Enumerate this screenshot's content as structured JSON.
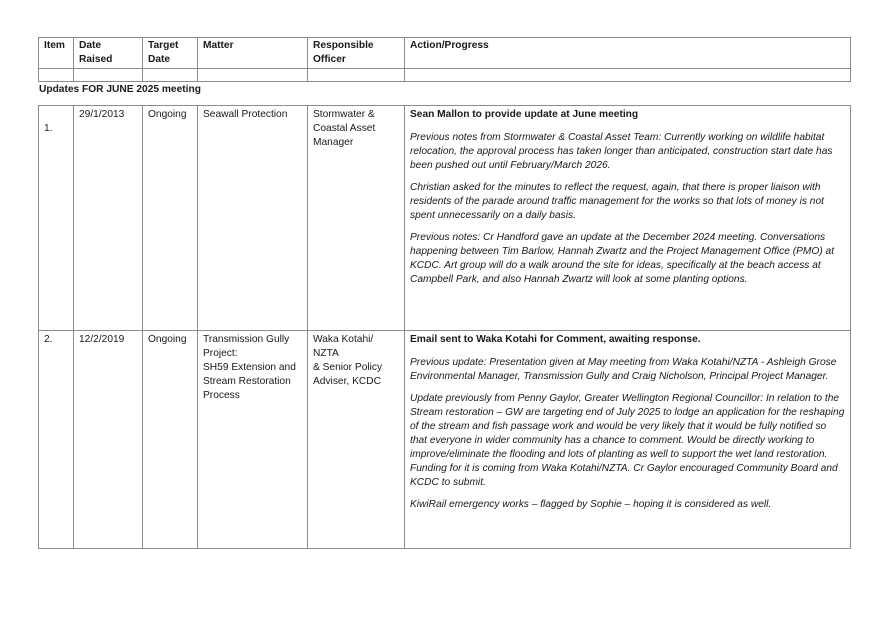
{
  "header": {
    "item": "Item",
    "date_raised": "Date Raised",
    "target_date": "Target Date",
    "matter": "Matter",
    "responsible_officer": "Responsible Officer",
    "action_progress": "Action/Progress"
  },
  "section_heading": "Updates FOR JUNE 2025 meeting",
  "rows": [
    {
      "item": "1.",
      "date_raised": "29/1/2013",
      "target_date": "Ongoing",
      "matter": "Seawall Protection",
      "responsible_officer": "Stormwater & Coastal Asset Manager",
      "lead": "Sean Mallon to provide update at June meeting",
      "notes": [
        "Previous notes from Stormwater & Coastal Asset Team: Currently working on wildlife habitat relocation, the approval process has taken longer than anticipated, construction start date has been pushed out until February/March 2026.",
        "Christian asked for the minutes to reflect the request, again, that there is proper liaison with residents of the parade around traffic management for the works so that lots of money is not spent unnecessarily on a daily basis.",
        "Previous notes: Cr Handford gave an update at the December 2024 meeting. Conversations happening between Tim Barlow, Hannah Zwartz and the Project Management Office (PMO) at KCDC. Art group will do a walk around the site for ideas, specifically at the beach access at Campbell Park, and also Hannah Zwartz will look at some planting options."
      ]
    },
    {
      "item": "2.",
      "date_raised": "12/2/2019",
      "target_date": "Ongoing",
      "matter_lines": [
        "Transmission Gully Project:",
        "SH59 Extension and Stream Restoration Process"
      ],
      "officer_lines": [
        "Waka Kotahi/ NZTA",
        "& Senior Policy Adviser, KCDC"
      ],
      "lead": "Email sent to Waka Kotahi for Comment, awaiting response.",
      "notes": [
        "Previous update: Presentation given at May meeting from Waka Kotahi/NZTA - Ashleigh Grose Environmental Manager, Transmission Gully and Craig Nicholson, Principal Project Manager.",
        "Update previously from Penny Gaylor, Greater Wellington Regional Councillor: In relation to the Stream restoration – GW are targeting end of July 2025 to lodge an application for the reshaping of the stream and fish passage work and would be very likely that it would be fully notified so that everyone in wider community has a chance to comment. Would be directly working to improve/eliminate the flooding and lots of planting as well to support the wet land restoration. Funding for it is coming from Waka Kotahi/NZTA. Cr Gaylor encouraged Community Board and KCDC to submit.",
        "KiwiRail emergency works – flagged by Sophie – hoping it is considered as well."
      ]
    }
  ]
}
